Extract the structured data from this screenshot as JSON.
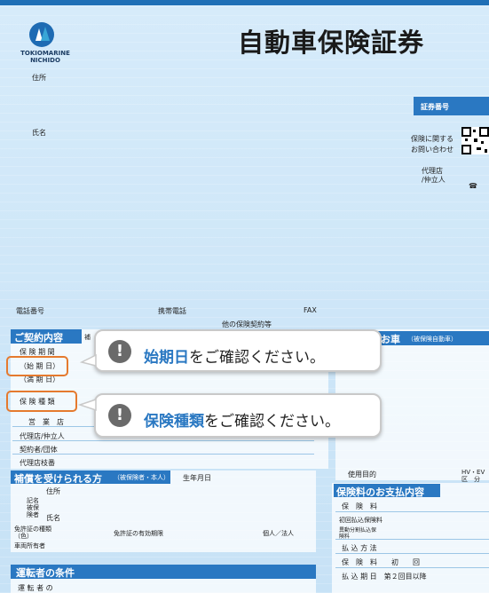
{
  "header": {
    "title": "自動車保険証券",
    "logo_line1": "TOKIOMARINE",
    "logo_line2": "NICHIDO"
  },
  "fields": {
    "address": "住所",
    "name": "氏名",
    "policy_number": "証券番号",
    "inquiry_line1": "保険に関する",
    "inquiry_line2": "お問い合わせ",
    "agent_line1": "代理店",
    "agent_line2": "/仲立人",
    "tel_icon": "☎",
    "phone": "電話番号",
    "mobile": "携帯電話",
    "fax": "FAX",
    "other_contracts": "他の保険契約等"
  },
  "contract": {
    "heading": "ご契約内容",
    "tag": "補",
    "rows": [
      "保 険 期 間",
      "（始 期 日）",
      "（満 期 日）",
      "保 険 種 類",
      "営　業　店",
      "代理店/仲立人",
      "契約者/団体",
      "代理店枝番"
    ]
  },
  "car": {
    "heading": "お車",
    "sub": "（被保険自動車）",
    "use_purpose": "使用目的",
    "hv": "HV・EV",
    "kubun": "区　分"
  },
  "insured": {
    "heading": "補償を受けられる方",
    "sub": "（被保険者・本人）",
    "dob": "生年月日",
    "rows": [
      "住所",
      "記名被保険者",
      "氏名",
      "免許証の種類（色）",
      "車両所有者"
    ],
    "license_valid": "免許証の有効期限",
    "individual": "個人／法人"
  },
  "payment": {
    "heading": "保険料のお支払内容",
    "rows": [
      "保　険　料",
      "初回払込保険料",
      "異動分割払込保険料",
      "払 込 方 法",
      "保　険　料　　初　　回",
      "払 込 期 日　第２回目以降"
    ]
  },
  "driver": {
    "heading": "運転者の条件",
    "row": "運 転 者 の"
  },
  "callouts": [
    {
      "highlight": "始期日",
      "rest": "をご確認ください。",
      "icon": "!"
    },
    {
      "highlight": "保険種類",
      "rest": "をご確認ください。",
      "icon": "!"
    }
  ],
  "colors": {
    "accent": "#2a78c2",
    "highlight": "#e57a2e"
  }
}
